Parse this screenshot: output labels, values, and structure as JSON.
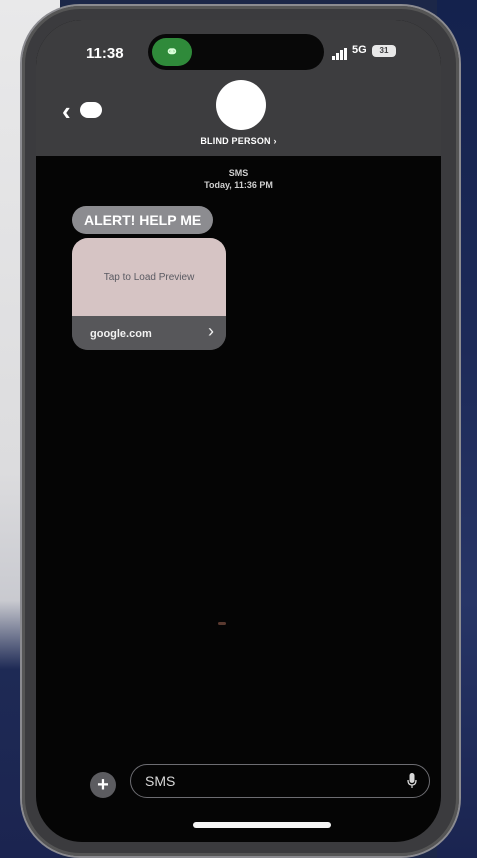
{
  "status_bar": {
    "time": "11:38",
    "network": "5G",
    "battery": "31"
  },
  "header": {
    "contact_name": "BLIND PERSON ›"
  },
  "conversation": {
    "service": "SMS",
    "timestamp": "Today, 11:36 PM",
    "messages": [
      {
        "text": "ALERT! HELP ME"
      }
    ],
    "link_preview": {
      "preview_text": "Tap to Load Preview",
      "domain": "google.com",
      "arrow": "›"
    }
  },
  "composer": {
    "placeholder": "SMS",
    "plus": "+"
  },
  "colors": {
    "header_bg": "#3d3d3f",
    "bubble": "#8c8c90",
    "preview_bg": "#d6c4c4",
    "link_icon": "#2f8a3a"
  }
}
